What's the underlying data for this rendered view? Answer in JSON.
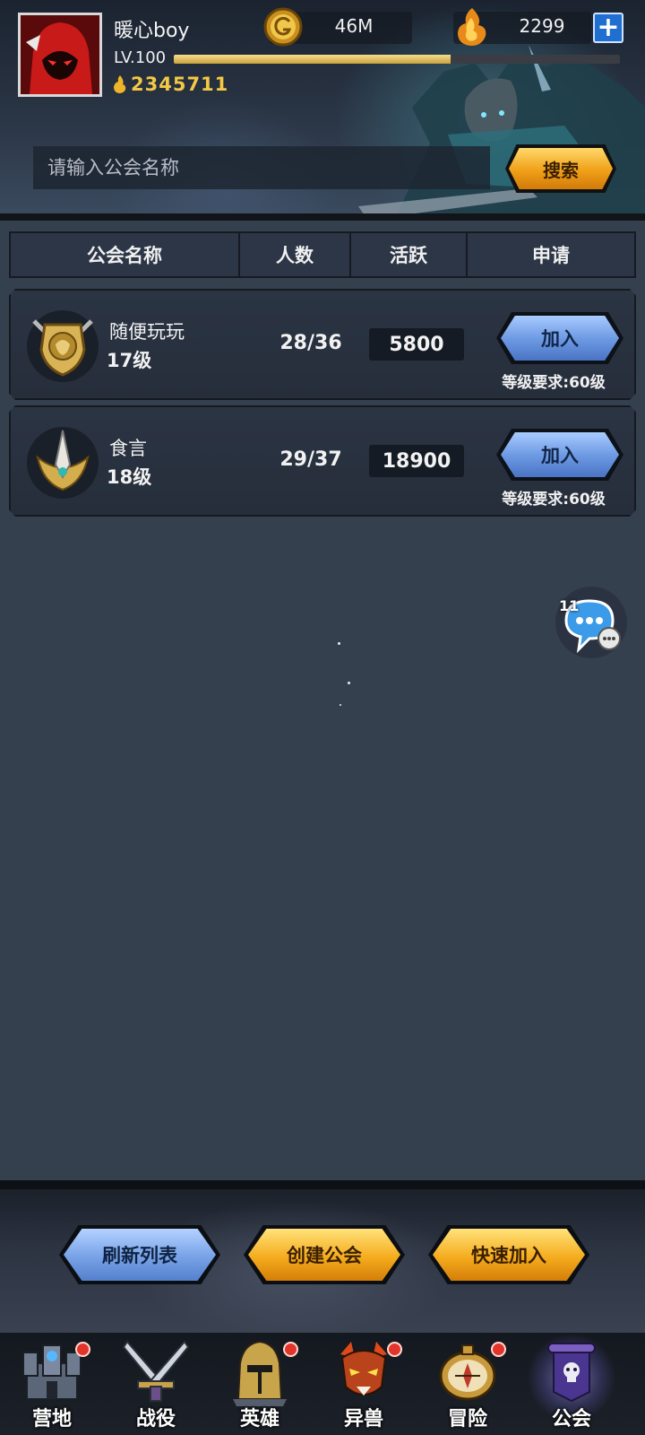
{
  "player": {
    "name": "暖心boy",
    "level": "LV.100",
    "xp_fraction": 0.62,
    "power": "2345711"
  },
  "resources": {
    "gold": "46M",
    "gems": "2299",
    "add_label": "+"
  },
  "search": {
    "placeholder": "请输入公会名称",
    "button_label": "搜索"
  },
  "table": {
    "columns": [
      "公会名称",
      "人数",
      "活跃",
      "申请"
    ]
  },
  "guilds": [
    {
      "name": "随便玩玩",
      "level": "17级",
      "members": "28/36",
      "activity": "5800",
      "join_label": "加入",
      "requirement": "等级要求:60级",
      "emblem": "lion-shield-icon"
    },
    {
      "name": "食言",
      "level": "18级",
      "members": "29/37",
      "activity": "18900",
      "join_label": "加入",
      "requirement": "等级要求:60级",
      "emblem": "winged-spire-icon"
    }
  ],
  "chat": {
    "unread": "11",
    "icon": "chat-bubble-icon"
  },
  "actions": {
    "refresh": "刷新列表",
    "create": "创建公会",
    "quick_join": "快速加入"
  },
  "nav": [
    {
      "label": "营地",
      "icon": "camp-castle-icon",
      "badge": true
    },
    {
      "label": "战役",
      "icon": "crossed-swords-icon",
      "badge": false
    },
    {
      "label": "英雄",
      "icon": "knight-helmet-icon",
      "badge": true
    },
    {
      "label": "异兽",
      "icon": "beast-icon",
      "badge": true
    },
    {
      "label": "冒险",
      "icon": "compass-icon",
      "badge": true
    },
    {
      "label": "公会",
      "icon": "guild-banner-icon",
      "badge": false,
      "active": true
    }
  ],
  "colors": {
    "background": "#35404f",
    "gold_button": "#f0a018",
    "blue_button": "#6f9be4",
    "power_text": "#f3c845",
    "badge": "#e3342b"
  }
}
